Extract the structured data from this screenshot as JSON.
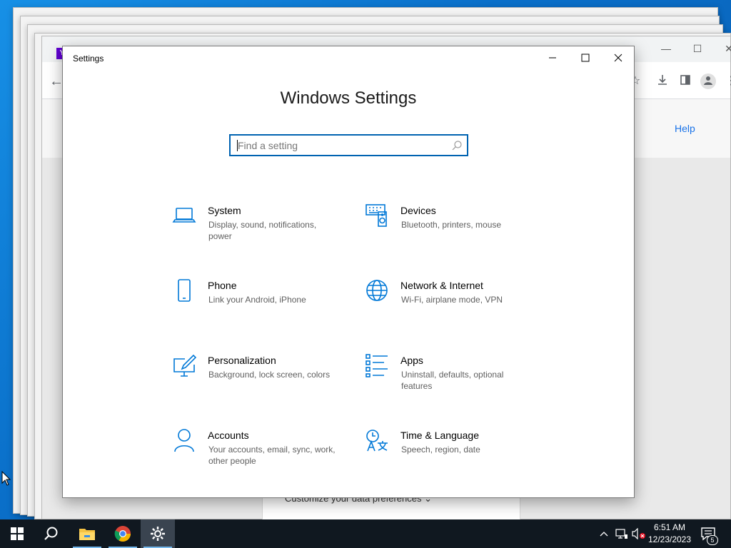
{
  "background_browser": {
    "help_link": "Help",
    "customize_text": "Customize your data preferences ⌄",
    "tab_favicon": "Y"
  },
  "settings_window": {
    "title": "Settings",
    "heading": "Windows Settings",
    "search": {
      "placeholder": "Find a setting"
    },
    "tiles": [
      {
        "name": "System",
        "desc": "Display, sound, notifications, power",
        "icon": "laptop-icon"
      },
      {
        "name": "Devices",
        "desc": "Bluetooth, printers, mouse",
        "icon": "keyboard-speaker-icon"
      },
      {
        "name": "Phone",
        "desc": "Link your Android, iPhone",
        "icon": "phone-icon"
      },
      {
        "name": "Network & Internet",
        "desc": "Wi-Fi, airplane mode, VPN",
        "icon": "globe-icon"
      },
      {
        "name": "Personalization",
        "desc": "Background, lock screen, colors",
        "icon": "paint-icon"
      },
      {
        "name": "Apps",
        "desc": "Uninstall, defaults, optional features",
        "icon": "apps-list-icon"
      },
      {
        "name": "Accounts",
        "desc": "Your accounts, email, sync, work, other people",
        "icon": "person-icon"
      },
      {
        "name": "Time & Language",
        "desc": "Speech, region, date",
        "icon": "time-language-icon"
      }
    ]
  },
  "taskbar": {
    "time": "6:51 AM",
    "date": "12/23/2023",
    "notification_count": "5"
  },
  "colors": {
    "accent": "#0078d7",
    "taskbar": "#101820"
  }
}
